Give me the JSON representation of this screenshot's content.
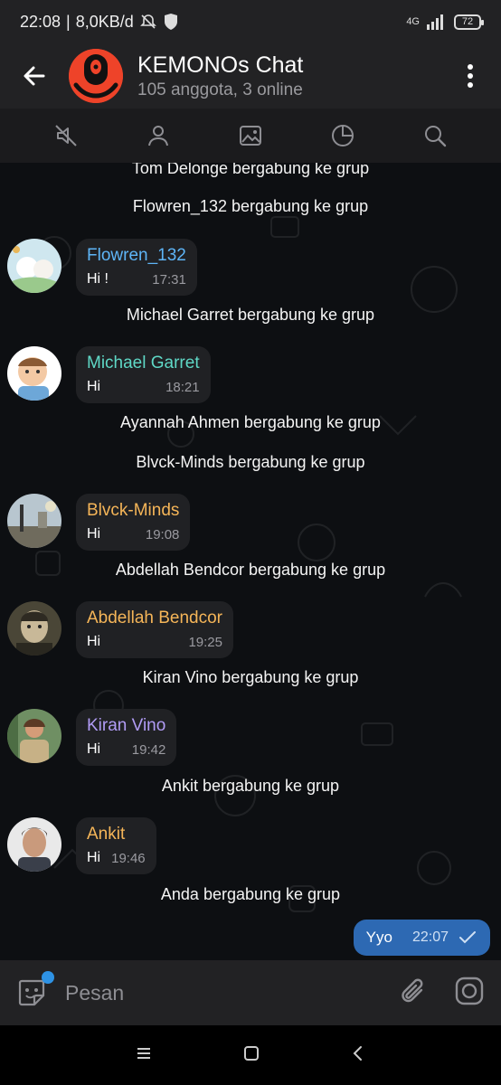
{
  "status_bar": {
    "time": "22:08",
    "speed": "8,0KB/d",
    "network": "4G",
    "battery": "72"
  },
  "header": {
    "title": "KEMONOs Chat",
    "subtitle": "105 anggota, 3 online"
  },
  "action_icons": [
    "mute-icon",
    "members-icon",
    "media-icon",
    "pie-icon",
    "search-icon"
  ],
  "system_messages": {
    "s0": "Tom Delonge bergabung ke grup",
    "s1": "Flowren_132 bergabung ke grup",
    "s2": "Michael Garret bergabung ke grup",
    "s3": "Ayannah Ahmen bergabung ke grup",
    "s4": "Blvck-Minds bergabung ke grup",
    "s5": "Abdellah Bendcor bergabung ke grup",
    "s6": "Kiran Vino bergabung ke grup",
    "s7": "Ankit bergabung ke grup",
    "s8": "Anda bergabung ke grup"
  },
  "messages": [
    {
      "name": "Flowren_132",
      "text": "Hi !",
      "time": "17:31",
      "color": "#5eb5f7"
    },
    {
      "name": "Michael Garret",
      "text": "Hi",
      "time": "18:21",
      "color": "#5fd8c6"
    },
    {
      "name": "Blvck-Minds",
      "text": "Hi",
      "time": "19:08",
      "color": "#f5b558"
    },
    {
      "name": "Abdellah Bendcor",
      "text": "Hi",
      "time": "19:25",
      "color": "#f5b558"
    },
    {
      "name": "Kiran Vino",
      "text": "Hi",
      "time": "19:42",
      "color": "#b19cf5"
    },
    {
      "name": "Ankit",
      "text": "Hi",
      "time": "19:46",
      "color": "#f5b558"
    }
  ],
  "outgoing": {
    "text": "Yyo",
    "time": "22:07"
  },
  "input": {
    "placeholder": "Pesan"
  },
  "colors": {
    "accent": "#2d69b3",
    "bubble": "#202124",
    "background": "#0d0f12"
  }
}
